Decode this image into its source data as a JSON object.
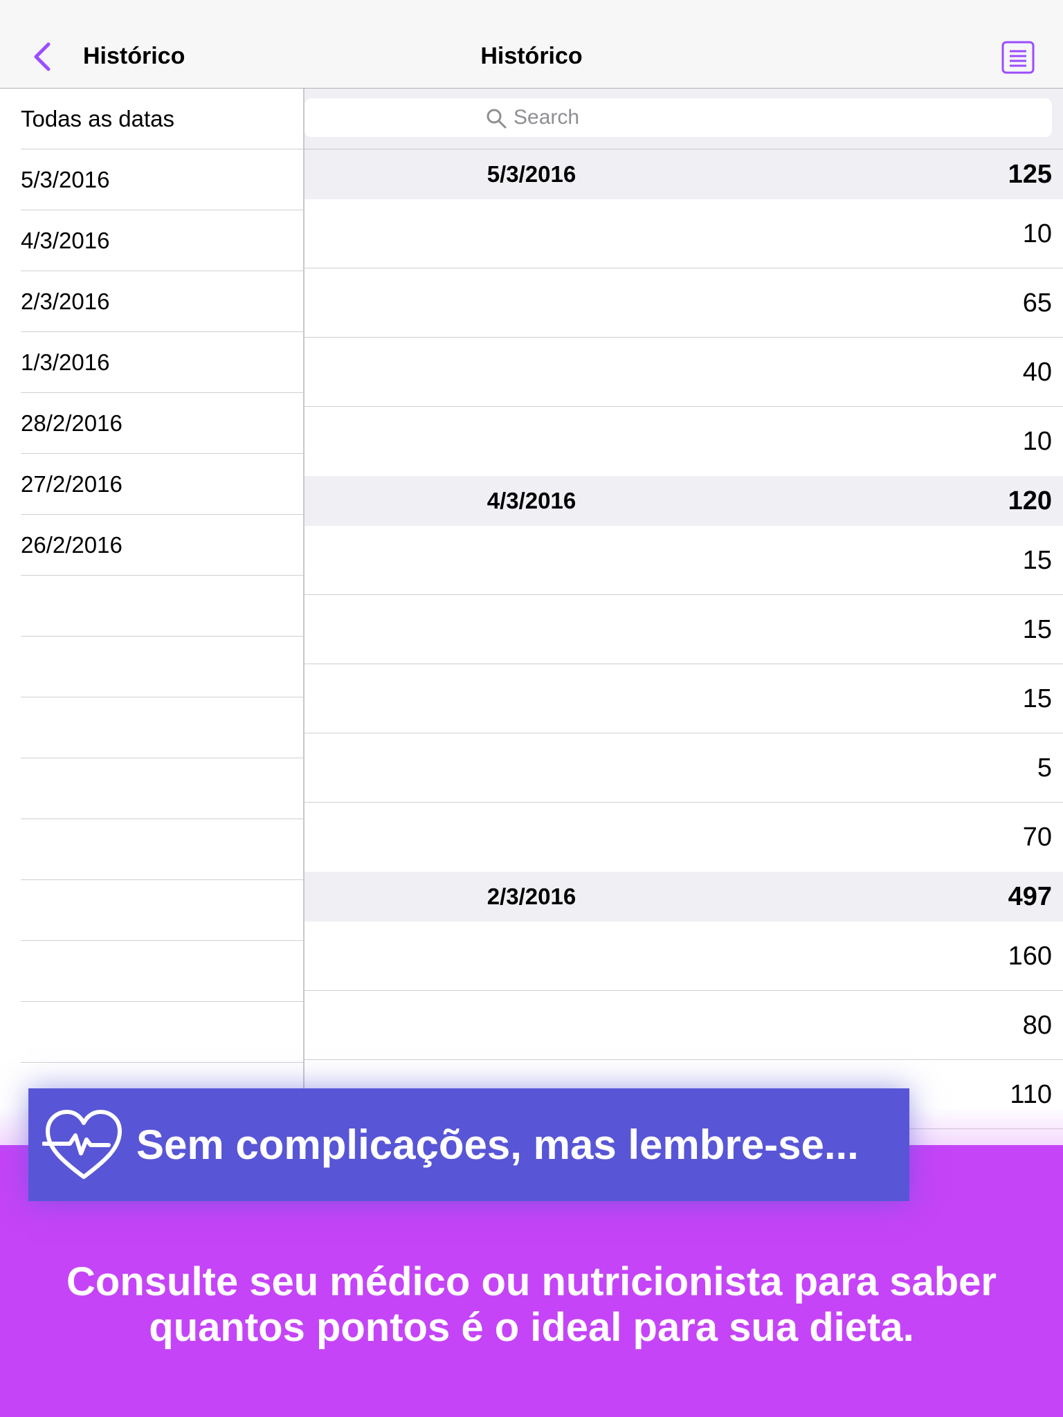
{
  "master": {
    "title": "Histórico",
    "items": [
      {
        "label": "Todas as datas"
      },
      {
        "label": "5/3/2016"
      },
      {
        "label": "4/3/2016"
      },
      {
        "label": "2/3/2016"
      },
      {
        "label": "1/3/2016"
      },
      {
        "label": "28/2/2016"
      },
      {
        "label": "27/2/2016"
      },
      {
        "label": "26/2/2016"
      },
      {
        "label": ""
      },
      {
        "label": ""
      },
      {
        "label": ""
      },
      {
        "label": ""
      },
      {
        "label": ""
      },
      {
        "label": ""
      },
      {
        "label": ""
      },
      {
        "label": ""
      }
    ]
  },
  "detail": {
    "title": "Histórico",
    "search_placeholder": "Search",
    "sections": [
      {
        "date": "5/3/2016",
        "total": "125",
        "entries": [
          "10",
          "65",
          "40",
          "10"
        ]
      },
      {
        "date": "4/3/2016",
        "total": "120",
        "entries": [
          "15",
          "15",
          "15",
          "5",
          "70"
        ]
      },
      {
        "date": "2/3/2016",
        "total": "497",
        "entries": [
          "160",
          "80",
          "110"
        ]
      }
    ]
  },
  "promo": {
    "banner_text": "Sem complicações, mas lembre-se...",
    "body_line1": "Consulte seu médico ou nutricionista para saber",
    "body_line2": "quantos pontos é o ideal para sua dieta."
  },
  "colors": {
    "accent": "#9b4dff",
    "banner": "#5856d6",
    "promo_bg": "#c544f8"
  }
}
